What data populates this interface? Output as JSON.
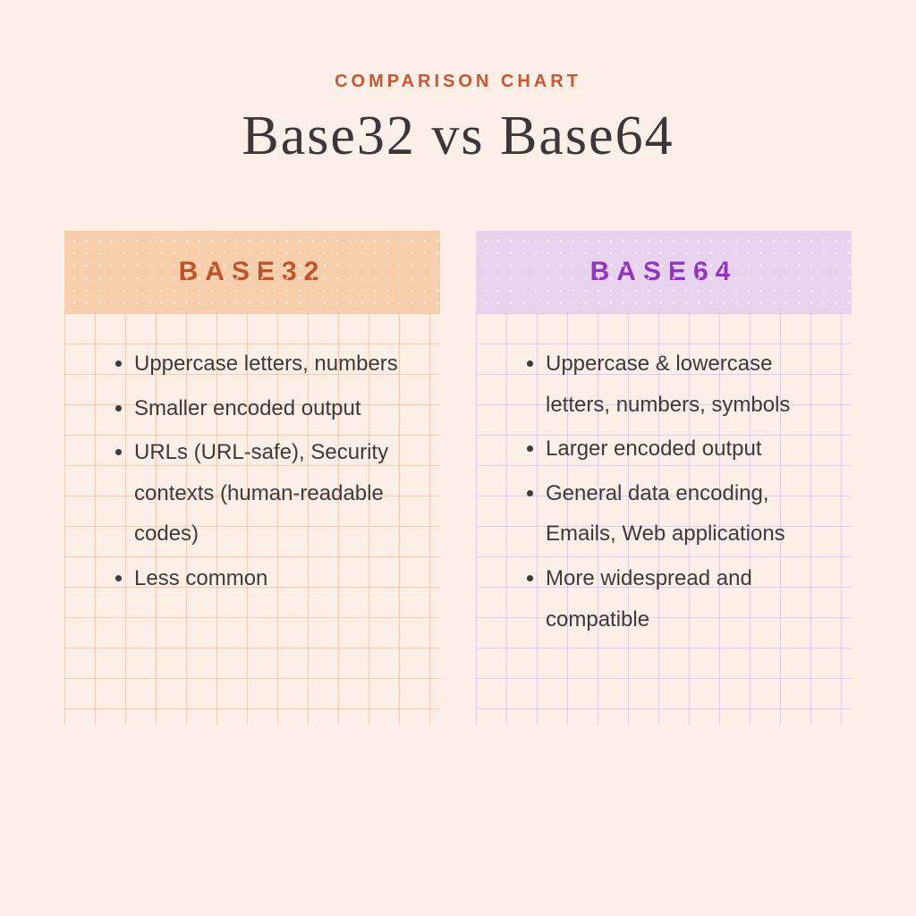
{
  "eyebrow": "COMPARISON CHART",
  "title": "Base32 vs Base64",
  "columns": [
    {
      "heading": "BASE32",
      "theme": "orange",
      "items": [
        "Uppercase letters, numbers",
        "Smaller encoded output",
        "URLs (URL-safe), Security contexts (human-readable codes)",
        "Less common"
      ]
    },
    {
      "heading": "BASE64",
      "theme": "purple",
      "items": [
        "Uppercase & lowercase letters, numbers, symbols",
        "Larger encoded output",
        "General data encoding, Emails, Web applications",
        "More widespread and compatible"
      ]
    }
  ]
}
